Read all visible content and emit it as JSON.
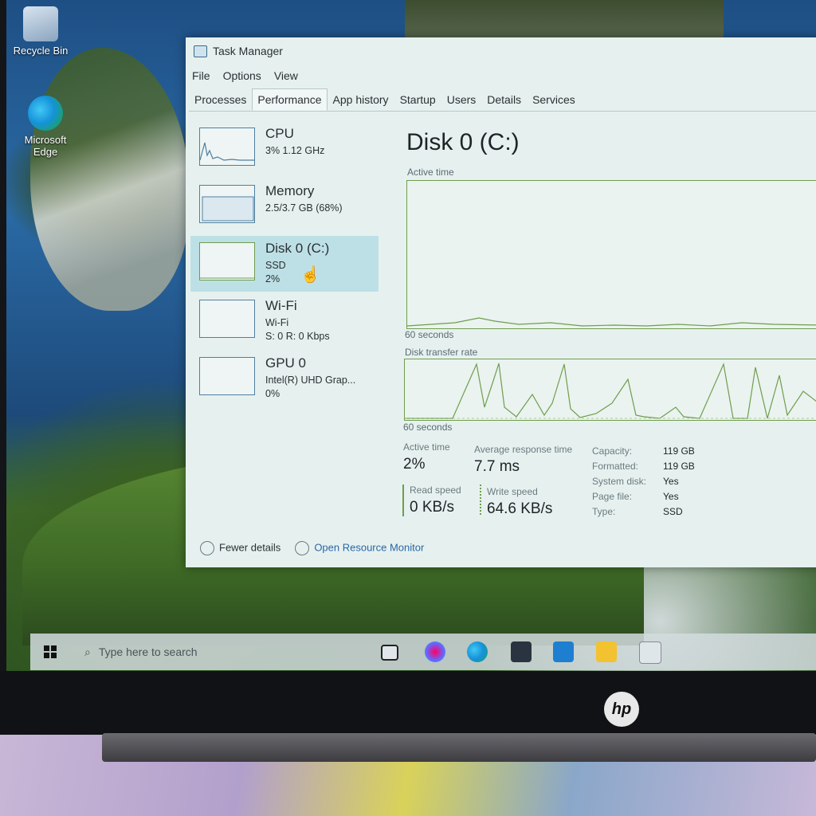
{
  "desktop": {
    "icons": [
      {
        "label": "Recycle Bin"
      },
      {
        "label": "Microsoft Edge"
      }
    ]
  },
  "window": {
    "title": "Task Manager",
    "menu": [
      "File",
      "Options",
      "View"
    ],
    "tabs": [
      "Processes",
      "Performance",
      "App history",
      "Startup",
      "Users",
      "Details",
      "Services"
    ],
    "active_tab": "Performance"
  },
  "sidebar": {
    "items": [
      {
        "name": "CPU",
        "line1": "3% 1.12 GHz",
        "line2": ""
      },
      {
        "name": "Memory",
        "line1": "2.5/3.7 GB (68%)",
        "line2": ""
      },
      {
        "name": "Disk 0 (C:)",
        "line1": "SSD",
        "line2": "2%"
      },
      {
        "name": "Wi-Fi",
        "line1": "Wi-Fi",
        "line2": "S: 0 R: 0 Kbps"
      },
      {
        "name": "GPU 0",
        "line1": "Intel(R) UHD Grap...",
        "line2": "0%"
      }
    ],
    "selected": "Disk 0 (C:)"
  },
  "detail": {
    "title": "Disk 0 (C:)",
    "graph1_label": "Active time",
    "graph1_footer": "60 seconds",
    "graph2_label": "Disk transfer rate",
    "graph2_footer": "60 seconds",
    "stats": {
      "active_time_label": "Active time",
      "active_time_value": "2%",
      "avg_response_label": "Average response time",
      "avg_response_value": "7.7 ms",
      "read_label": "Read speed",
      "read_value": "0 KB/s",
      "write_label": "Write speed",
      "write_value": "64.6 KB/s"
    },
    "properties": [
      {
        "key": "Capacity:",
        "value": "119 GB"
      },
      {
        "key": "Formatted:",
        "value": "119 GB"
      },
      {
        "key": "System disk:",
        "value": "Yes"
      },
      {
        "key": "Page file:",
        "value": "Yes"
      },
      {
        "key": "Type:",
        "value": "SSD"
      }
    ]
  },
  "footer": {
    "fewer_details": "Fewer details",
    "open_resource_monitor": "Open Resource Monitor"
  },
  "taskbar": {
    "search_placeholder": "Type here to search"
  },
  "laptop": {
    "brand": "hp"
  },
  "colors": {
    "accent_green": "#6f9d4e",
    "selection": "#bde0e6",
    "link": "#2a66a8"
  }
}
